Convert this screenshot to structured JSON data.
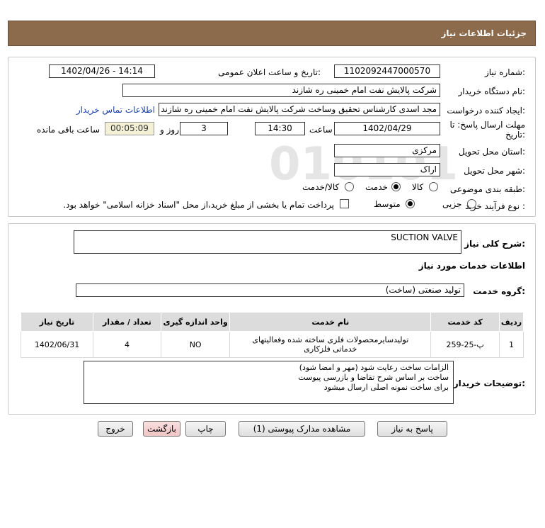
{
  "header": {
    "title": "جزئیات اطلاعات نیاز"
  },
  "form": {
    "need_number_label": "شماره نیاز:",
    "need_number": "1102092447000570",
    "announce_label": "تاریخ و ساعت اعلان عمومی:",
    "announce_value": "1402/04/26 - 14:14",
    "buyer_org_label": "نام دستگاه خریدار:",
    "buyer_org": "شرکت پالایش نفت امام خمینی  ره  شازند",
    "creator_label": "ایجاد کننده درخواست:",
    "creator": "مجد اسدی کارشناس تحقیق وساخت شرکت پالایش نفت امام خمینی  ره  شازند",
    "contact_link": "اطلاعات تماس خریدار",
    "deadline_label_1": "مهلت ارسال پاسخ: تا",
    "deadline_label_2": "تاریخ:",
    "deadline_date": "1402/04/29",
    "time_label": "ساعت",
    "deadline_time": "14:30",
    "days_value": "3",
    "days_label": "روز و",
    "remaining_time": "00:05:09",
    "remaining_label": "ساعت باقی مانده",
    "province_label": "استان محل تحویل:",
    "province": "مرکزی",
    "city_label": "شهر محل تحویل:",
    "city": "اراک",
    "category_label": "طبقه بندی موضوعی:",
    "category_options": [
      "کالا",
      "خدمت",
      "کالا/خدمت"
    ],
    "category_selected": "خدمت",
    "process_label": "نوع فرآیند خرید :",
    "process_options": [
      "جزیی",
      "متوسط"
    ],
    "process_selected": "متوسط",
    "treasury_note": "پرداخت تمام یا بخشی از مبلغ خرید،از محل \"اسناد خزانه اسلامی\" خواهد بود."
  },
  "summary": {
    "label": "شرح کلی نیاز:",
    "value": "SUCTION VALVE",
    "services_heading": "اطلاعات خدمات مورد نیاز",
    "service_group_label": "گروه خدمت:",
    "service_group": "تولید صنعتی (ساخت)"
  },
  "table": {
    "headers": [
      "ردیف",
      "کد خدمت",
      "نام خدمت",
      "واحد اندازه گیری",
      "تعداد / مقدار",
      "تاریخ نیاز"
    ],
    "rows": [
      [
        "1",
        "پ-25-259",
        "تولیدسایرمحصولات فلزی ساخته شده وفعالیتهای خدماتی فلزکاری",
        "NO",
        "4",
        "1402/06/31"
      ]
    ]
  },
  "notes": {
    "label": "توضیحات خریدار:",
    "lines": [
      "الزامات ساخت رعایت شود (مهر و امضا شود)",
      "ساخت بر اساس شرح تقاضا و بازرسی پیوست",
      "برای ساخت نمونه اصلی ارسال میشود"
    ]
  },
  "buttons": {
    "reply": "پاسخ به نیاز",
    "attachments": "مشاهده مدارک پیوستی (1)",
    "print": "چاپ",
    "back": "بازگشت",
    "exit": "خروج"
  },
  "watermark": {
    "brand": "ParsNamadData",
    "phone": "۰۲۱-۸۸۳۴۹۶۷۰"
  },
  "colors": {
    "header_bg": "#8c6b4c",
    "link": "#1a3ea8",
    "time_bg": "#f3f0d6",
    "back_btn_bg": "#f4d0d0"
  }
}
